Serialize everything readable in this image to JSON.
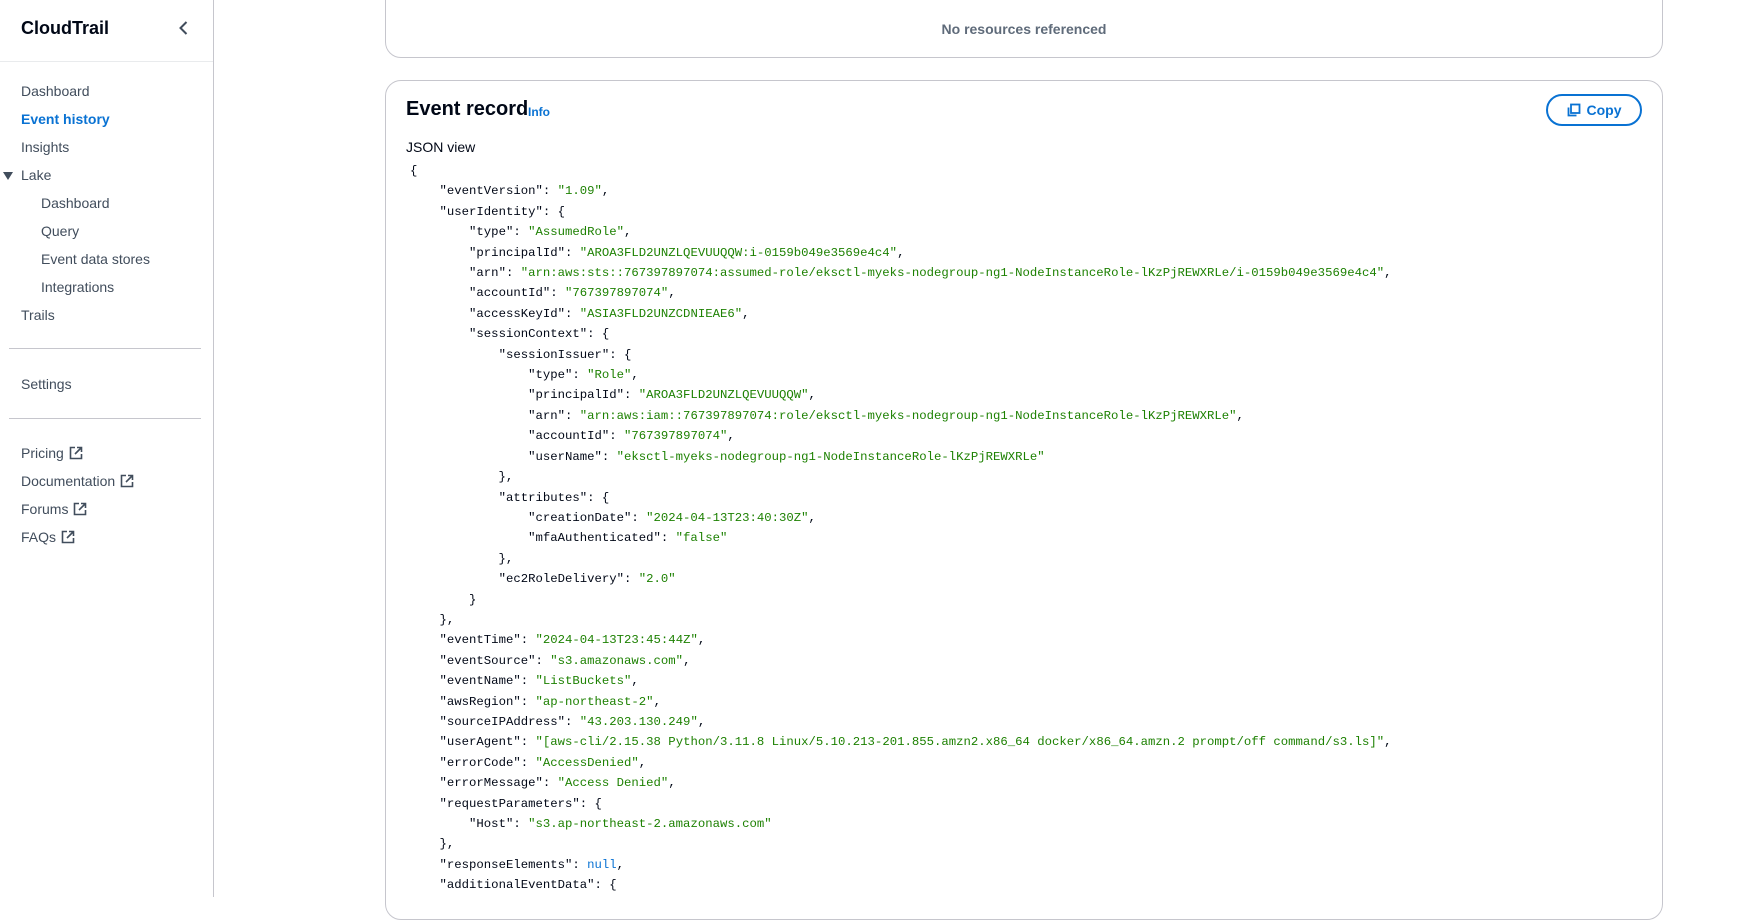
{
  "sidebar": {
    "title": "CloudTrail",
    "items": [
      {
        "label": "Dashboard"
      },
      {
        "label": "Event history"
      },
      {
        "label": "Insights"
      },
      {
        "label": "Lake"
      },
      {
        "label": "Dashboard"
      },
      {
        "label": "Query"
      },
      {
        "label": "Event data stores"
      },
      {
        "label": "Integrations"
      },
      {
        "label": "Trails"
      },
      {
        "label": "Settings"
      },
      {
        "label": "Pricing"
      },
      {
        "label": "Documentation"
      },
      {
        "label": "Forums"
      },
      {
        "label": "FAQs"
      }
    ]
  },
  "resources": {
    "empty_text": "No resources referenced"
  },
  "event_record": {
    "title": "Event record",
    "info_label": "Info",
    "copy_label": "Copy",
    "view_label": "JSON view",
    "json_lines": [
      [
        [
          "p",
          "{"
        ]
      ],
      [
        [
          "p",
          "    "
        ],
        [
          "k",
          "\"eventVersion\""
        ],
        [
          "p",
          ": "
        ],
        [
          "s",
          "\"1.09\""
        ],
        [
          "p",
          ","
        ]
      ],
      [
        [
          "p",
          "    "
        ],
        [
          "k",
          "\"userIdentity\""
        ],
        [
          "p",
          ": {"
        ]
      ],
      [
        [
          "p",
          "        "
        ],
        [
          "k",
          "\"type\""
        ],
        [
          "p",
          ": "
        ],
        [
          "s",
          "\"AssumedRole\""
        ],
        [
          "p",
          ","
        ]
      ],
      [
        [
          "p",
          "        "
        ],
        [
          "k",
          "\"principalId\""
        ],
        [
          "p",
          ": "
        ],
        [
          "s",
          "\"AROA3FLD2UNZLQEVUUQQW:i-0159b049e3569e4c4\""
        ],
        [
          "p",
          ","
        ]
      ],
      [
        [
          "p",
          "        "
        ],
        [
          "k",
          "\"arn\""
        ],
        [
          "p",
          ": "
        ],
        [
          "s",
          "\"arn:aws:sts::767397897074:assumed-role/eksctl-myeks-nodegroup-ng1-NodeInstanceRole-lKzPjREWXRLe/i-0159b049e3569e4c4\""
        ],
        [
          "p",
          ","
        ]
      ],
      [
        [
          "p",
          "        "
        ],
        [
          "k",
          "\"accountId\""
        ],
        [
          "p",
          ": "
        ],
        [
          "s",
          "\"767397897074\""
        ],
        [
          "p",
          ","
        ]
      ],
      [
        [
          "p",
          "        "
        ],
        [
          "k",
          "\"accessKeyId\""
        ],
        [
          "p",
          ": "
        ],
        [
          "s",
          "\"ASIA3FLD2UNZCDNIEAE6\""
        ],
        [
          "p",
          ","
        ]
      ],
      [
        [
          "p",
          "        "
        ],
        [
          "k",
          "\"sessionContext\""
        ],
        [
          "p",
          ": {"
        ]
      ],
      [
        [
          "p",
          "            "
        ],
        [
          "k",
          "\"sessionIssuer\""
        ],
        [
          "p",
          ": {"
        ]
      ],
      [
        [
          "p",
          "                "
        ],
        [
          "k",
          "\"type\""
        ],
        [
          "p",
          ": "
        ],
        [
          "s",
          "\"Role\""
        ],
        [
          "p",
          ","
        ]
      ],
      [
        [
          "p",
          "                "
        ],
        [
          "k",
          "\"principalId\""
        ],
        [
          "p",
          ": "
        ],
        [
          "s",
          "\"AROA3FLD2UNZLQEVUUQQW\""
        ],
        [
          "p",
          ","
        ]
      ],
      [
        [
          "p",
          "                "
        ],
        [
          "k",
          "\"arn\""
        ],
        [
          "p",
          ": "
        ],
        [
          "s",
          "\"arn:aws:iam::767397897074:role/eksctl-myeks-nodegroup-ng1-NodeInstanceRole-lKzPjREWXRLe\""
        ],
        [
          "p",
          ","
        ]
      ],
      [
        [
          "p",
          "                "
        ],
        [
          "k",
          "\"accountId\""
        ],
        [
          "p",
          ": "
        ],
        [
          "s",
          "\"767397897074\""
        ],
        [
          "p",
          ","
        ]
      ],
      [
        [
          "p",
          "                "
        ],
        [
          "k",
          "\"userName\""
        ],
        [
          "p",
          ": "
        ],
        [
          "s",
          "\"eksctl-myeks-nodegroup-ng1-NodeInstanceRole-lKzPjREWXRLe\""
        ]
      ],
      [
        [
          "p",
          "            },"
        ]
      ],
      [
        [
          "p",
          "            "
        ],
        [
          "k",
          "\"attributes\""
        ],
        [
          "p",
          ": {"
        ]
      ],
      [
        [
          "p",
          "                "
        ],
        [
          "k",
          "\"creationDate\""
        ],
        [
          "p",
          ": "
        ],
        [
          "s",
          "\"2024-04-13T23:40:30Z\""
        ],
        [
          "p",
          ","
        ]
      ],
      [
        [
          "p",
          "                "
        ],
        [
          "k",
          "\"mfaAuthenticated\""
        ],
        [
          "p",
          ": "
        ],
        [
          "s",
          "\"false\""
        ]
      ],
      [
        [
          "p",
          "            },"
        ]
      ],
      [
        [
          "p",
          "            "
        ],
        [
          "k",
          "\"ec2RoleDelivery\""
        ],
        [
          "p",
          ": "
        ],
        [
          "s",
          "\"2.0\""
        ]
      ],
      [
        [
          "p",
          "        }"
        ]
      ],
      [
        [
          "p",
          "    },"
        ]
      ],
      [
        [
          "p",
          "    "
        ],
        [
          "k",
          "\"eventTime\""
        ],
        [
          "p",
          ": "
        ],
        [
          "s",
          "\"2024-04-13T23:45:44Z\""
        ],
        [
          "p",
          ","
        ]
      ],
      [
        [
          "p",
          "    "
        ],
        [
          "k",
          "\"eventSource\""
        ],
        [
          "p",
          ": "
        ],
        [
          "s",
          "\"s3.amazonaws.com\""
        ],
        [
          "p",
          ","
        ]
      ],
      [
        [
          "p",
          "    "
        ],
        [
          "k",
          "\"eventName\""
        ],
        [
          "p",
          ": "
        ],
        [
          "s",
          "\"ListBuckets\""
        ],
        [
          "p",
          ","
        ]
      ],
      [
        [
          "p",
          "    "
        ],
        [
          "k",
          "\"awsRegion\""
        ],
        [
          "p",
          ": "
        ],
        [
          "s",
          "\"ap-northeast-2\""
        ],
        [
          "p",
          ","
        ]
      ],
      [
        [
          "p",
          "    "
        ],
        [
          "k",
          "\"sourceIPAddress\""
        ],
        [
          "p",
          ": "
        ],
        [
          "s",
          "\"43.203.130.249\""
        ],
        [
          "p",
          ","
        ]
      ],
      [
        [
          "p",
          "    "
        ],
        [
          "k",
          "\"userAgent\""
        ],
        [
          "p",
          ": "
        ],
        [
          "s",
          "\"[aws-cli/2.15.38 Python/3.11.8 Linux/5.10.213-201.855.amzn2.x86_64 docker/x86_64.amzn.2 prompt/off command/s3.ls]\""
        ],
        [
          "p",
          ","
        ]
      ],
      [
        [
          "p",
          "    "
        ],
        [
          "k",
          "\"errorCode\""
        ],
        [
          "p",
          ": "
        ],
        [
          "s",
          "\"AccessDenied\""
        ],
        [
          "p",
          ","
        ]
      ],
      [
        [
          "p",
          "    "
        ],
        [
          "k",
          "\"errorMessage\""
        ],
        [
          "p",
          ": "
        ],
        [
          "s",
          "\"Access Denied\""
        ],
        [
          "p",
          ","
        ]
      ],
      [
        [
          "p",
          "    "
        ],
        [
          "k",
          "\"requestParameters\""
        ],
        [
          "p",
          ": {"
        ]
      ],
      [
        [
          "p",
          "        "
        ],
        [
          "k",
          "\"Host\""
        ],
        [
          "p",
          ": "
        ],
        [
          "s",
          "\"s3.ap-northeast-2.amazonaws.com\""
        ]
      ],
      [
        [
          "p",
          "    },"
        ]
      ],
      [
        [
          "p",
          "    "
        ],
        [
          "k",
          "\"responseElements\""
        ],
        [
          "p",
          ": "
        ],
        [
          "n",
          "null"
        ],
        [
          "p",
          ","
        ]
      ],
      [
        [
          "p",
          "    "
        ],
        [
          "k",
          "\"additionalEventData\""
        ],
        [
          "p",
          ": {"
        ]
      ]
    ]
  }
}
